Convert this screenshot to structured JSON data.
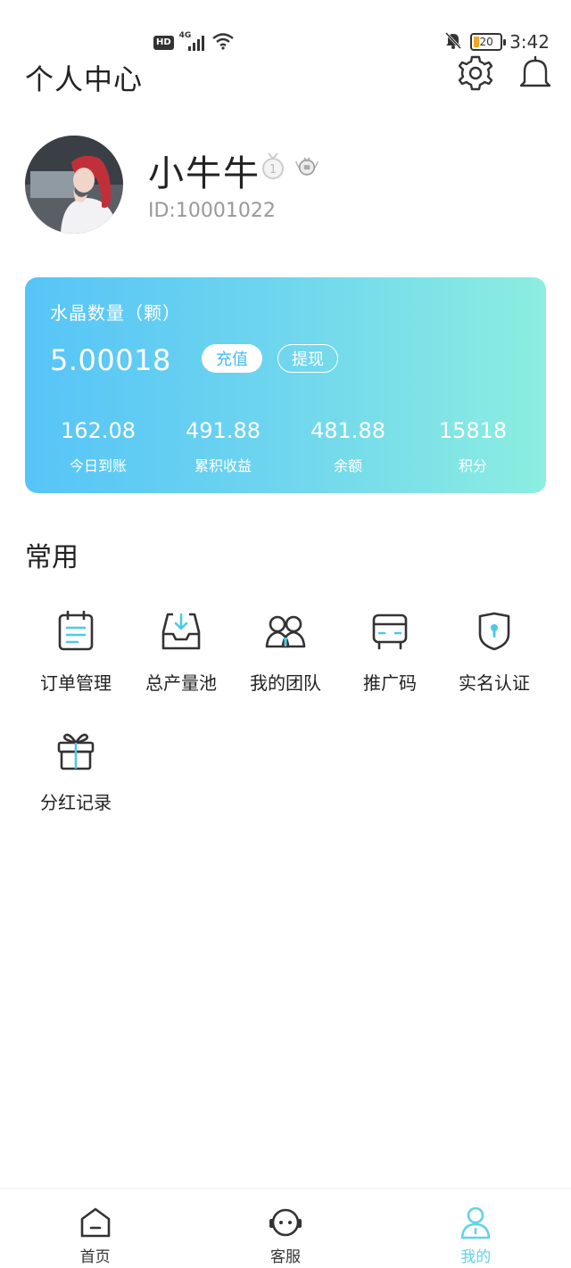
{
  "status_bar": {
    "hd_label": "HD",
    "network_label": "4G",
    "battery_level": 20,
    "battery_text": "20",
    "time": "3:42"
  },
  "header": {
    "title": "个人中心",
    "settings_icon": "gear-icon",
    "notification_icon": "bell-icon"
  },
  "profile": {
    "username": "小牛牛",
    "user_id": "ID:10001022"
  },
  "crystal_card": {
    "title": "水晶数量（颗）",
    "amount": "5.00018",
    "recharge_label": "充值",
    "withdraw_label": "提现",
    "stats": [
      {
        "value": "162.08",
        "label": "今日到账"
      },
      {
        "value": "491.88",
        "label": "累积收益"
      },
      {
        "value": "481.88",
        "label": "余额"
      },
      {
        "value": "15818",
        "label": "积分"
      }
    ]
  },
  "common": {
    "title": "常用",
    "items": [
      {
        "label": "订单管理",
        "icon": "clipboard-list-icon"
      },
      {
        "label": "总产量池",
        "icon": "inbox-download-icon"
      },
      {
        "label": "我的团队",
        "icon": "team-icon"
      },
      {
        "label": "推广码",
        "icon": "bus-icon"
      },
      {
        "label": "实名认证",
        "icon": "shield-lock-icon"
      },
      {
        "label": "分红记录",
        "icon": "gift-icon"
      }
    ]
  },
  "bottom_nav": {
    "items": [
      {
        "label": "首页",
        "icon": "home-icon"
      },
      {
        "label": "客服",
        "icon": "customer-service-icon"
      },
      {
        "label": "我的",
        "icon": "user-icon"
      }
    ],
    "active_index": 2
  },
  "colors": {
    "accent": "#62d2e8",
    "card_gradient_start": "#56c4f7",
    "card_gradient_end": "#8ceee0",
    "icon_accent": "#4ec9e6",
    "icon_stroke": "#333333"
  }
}
